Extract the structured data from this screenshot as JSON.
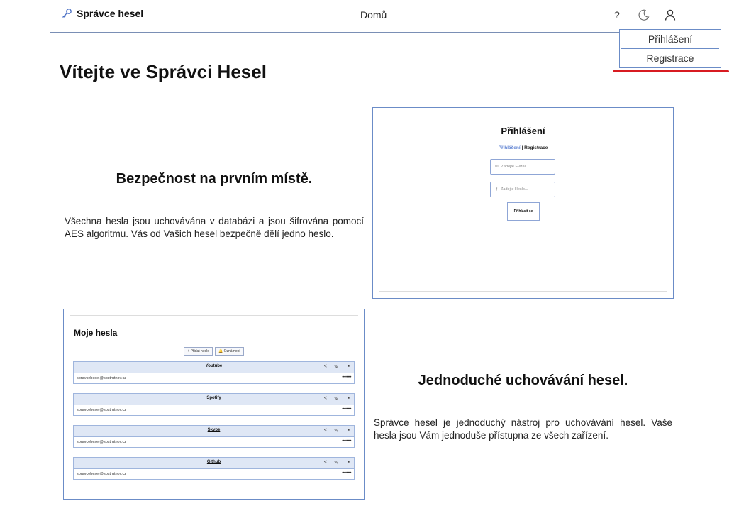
{
  "nav": {
    "brand": "Správce hesel",
    "home": "Domů",
    "help": "?",
    "dropdown": [
      "Přihlášení",
      "Registrace"
    ]
  },
  "page_title": "Vítejte ve Správci Hesel",
  "section1": {
    "heading": "Bezpečnost na prvním místě.",
    "text": "Všechna hesla jsou uchovávána v databázi a jsou šifrována pomocí AES algoritmu. Vás od Vašich hesel bezpečně dělí jedno heslo."
  },
  "section2": {
    "heading": "Jednoduché uchovávání hesel.",
    "text": "Správce hesel je jednoduchý nástroj pro uchovávání hesel. Vaše hesla jsou Vám jednoduše přístupna ze všech zařízení."
  },
  "login_preview": {
    "title": "Přihlášení",
    "link_login": "Přihlášení",
    "link_separator": "|",
    "link_register": "Registrace",
    "email_placeholder": "Zadejte E-Mail...",
    "password_placeholder": "Zadejte Heslo...",
    "submit": "Přihlásit se"
  },
  "passwords_preview": {
    "title": "Moje hesla",
    "add_button": "+ Přidat heslo",
    "notify_button": "Oznámení",
    "entries": [
      {
        "name": "Youtube",
        "email": "spravcehesel@spstrutnov.cz",
        "password": "••••••••"
      },
      {
        "name": "Spotify",
        "email": "spravcehesel@spstrutnov.cz",
        "password": "••••••••"
      },
      {
        "name": "Skype",
        "email": "spravcehesel@spstrutnov.cz",
        "password": "••••••••"
      },
      {
        "name": "Github",
        "email": "spravcehesel@spstrutnov.cz",
        "password": "••••••••"
      }
    ]
  },
  "colors": {
    "accent_border": "#6b8cc7",
    "highlight_underline": "#d81b21",
    "card_header": "#dfe7f5"
  }
}
